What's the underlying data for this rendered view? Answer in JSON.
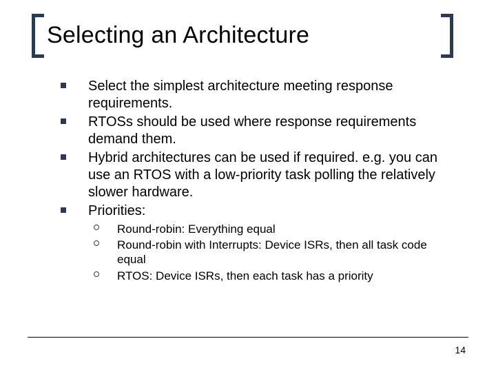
{
  "title": "Selecting an Architecture",
  "bullets": {
    "b1": "Select the simplest architecture meeting response requirements.",
    "b2": "RTOSs should be used where response requirements demand them.",
    "b3": "Hybrid architectures can be used if required. e.g. you can use an RTOS with a low-priority task polling the relatively slower hardware.",
    "b4": "Priorities:"
  },
  "sub": {
    "s1": "Round-robin:  Everything equal",
    "s2": "Round-robin with Interrupts:   Device ISRs, then all task code equal",
    "s3": "RTOS:  Device ISRs, then each task has a priority"
  },
  "page_number": "14"
}
